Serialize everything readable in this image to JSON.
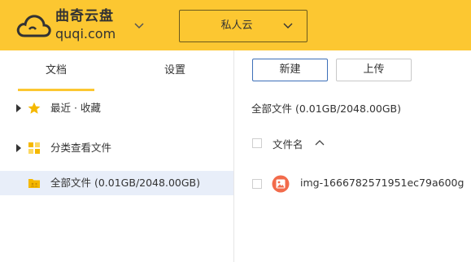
{
  "header": {
    "logo_cn": "曲奇云盘",
    "logo_en": "quqi.com",
    "space_selector": "私人云"
  },
  "sidebar": {
    "tabs": [
      {
        "label": "文档",
        "active": true
      },
      {
        "label": "设置",
        "active": false
      }
    ],
    "items": [
      {
        "label": "最近 · 收藏",
        "icon": "star-icon",
        "expandable": true
      },
      {
        "label": "分类查看文件",
        "icon": "category-grid-icon",
        "expandable": true
      },
      {
        "label": "全部文件 (0.01GB/2048.00GB)",
        "icon": "folder-icon",
        "expandable": false,
        "selected": true
      }
    ]
  },
  "toolbar": {
    "new_label": "新建",
    "upload_label": "上传"
  },
  "breadcrumb": "全部文件 (0.01GB/2048.00GB)",
  "file_list": {
    "column_name": "文件名",
    "sort": "ascending",
    "files": [
      {
        "name": "img-1666782571951ec79a600g",
        "icon": "image-file-icon"
      }
    ]
  },
  "colors": {
    "brand": "#fcc731",
    "primary_border": "#3d6fb8",
    "selected_row": "#e8eef9",
    "image_icon": "#f26b4b"
  }
}
